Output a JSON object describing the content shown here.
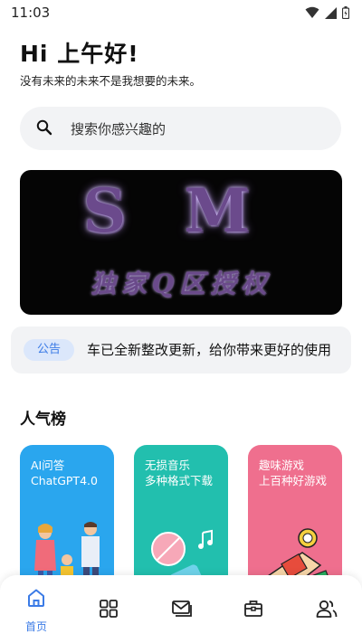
{
  "status": {
    "time": "11:03"
  },
  "header": {
    "greeting": "Hi 上午好!",
    "subtitle": "没有未来的未来不是我想要的未来。"
  },
  "search": {
    "placeholder": "搜索你感兴趣的"
  },
  "banner": {
    "big_text": "SM",
    "tagline": "独家Q区授权"
  },
  "notice": {
    "label": "公告",
    "text": "车已全新整改更新，给你带来更好的使用"
  },
  "popular": {
    "title": "人气榜",
    "cards": [
      {
        "line1": "AI问答",
        "line2": "ChatGPT4.0",
        "color": "#2aa6ee"
      },
      {
        "line1": "无损音乐",
        "line2": "多种格式下载",
        "color": "#22bfae"
      },
      {
        "line1": "趣味游戏",
        "line2": "上百种好游戏",
        "color": "#ef6f8e"
      }
    ]
  },
  "nav": {
    "home_label": "首页",
    "accent": "#3b7be6"
  }
}
